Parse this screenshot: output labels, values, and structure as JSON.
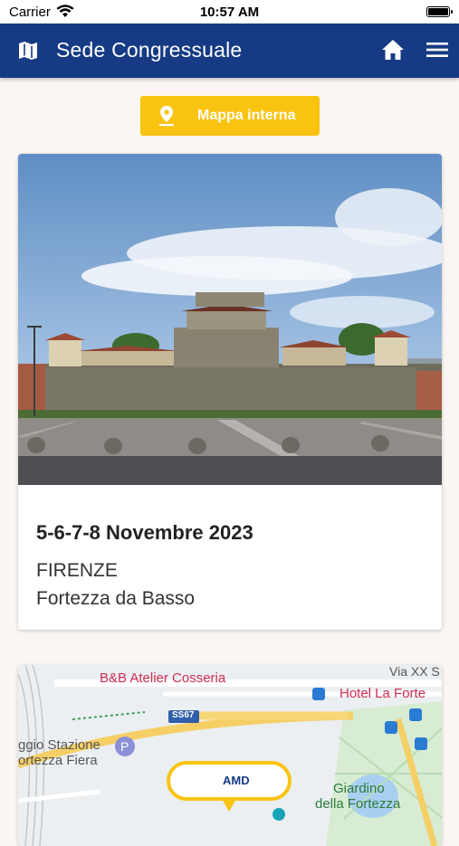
{
  "status_bar": {
    "carrier": "Carrier",
    "time": "10:57 AM"
  },
  "header": {
    "title": "Sede Congressuale",
    "icons": [
      "map-icon",
      "home-icon",
      "menu-icon"
    ]
  },
  "map_button": {
    "label": "Mappa interna",
    "icon": "location-pin-icon",
    "color": "#f9c311"
  },
  "event": {
    "dates": "5-6-7-8 Novembre 2023",
    "city": "FIRENZE",
    "venue": "Fortezza da Basso"
  },
  "map": {
    "labels": {
      "bb": "B&B Atelier Cosseria",
      "via": "Via XX S",
      "hotel": "Hotel La Forte",
      "road": "SS67",
      "station_1": "ggio Stazione",
      "station_2": "ortezza Fiera",
      "garden_1": "Giardino",
      "garden_2": "della Fortezza"
    },
    "marker_text": "AMD"
  },
  "colors": {
    "primary": "#163a84",
    "accent": "#f9c311",
    "background": "#fbf6f3"
  }
}
